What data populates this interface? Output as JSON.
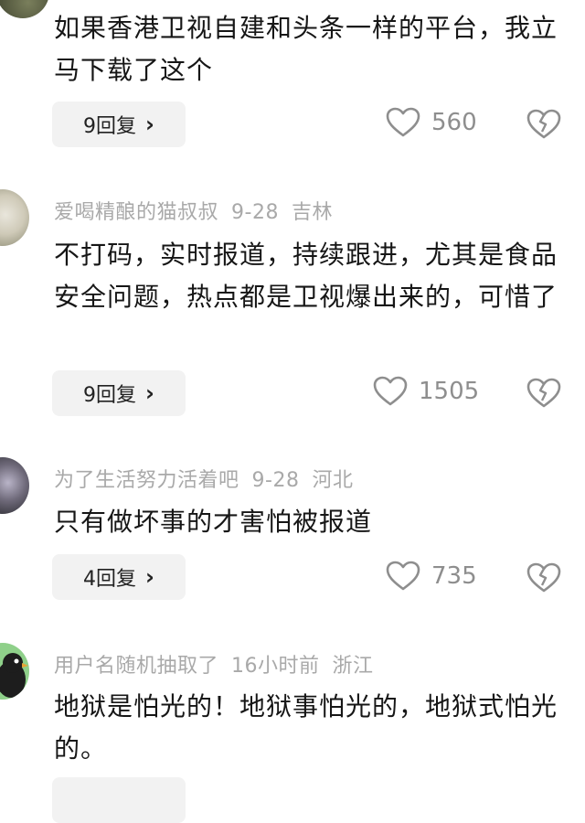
{
  "comments": [
    {
      "content": "如果香港卫视自建和头条一样的平台，我立马下载了这个",
      "replies_label": "9回复",
      "likes": "560"
    },
    {
      "username": "爱喝精酿的猫叔叔",
      "date": "9-28",
      "location": "吉林",
      "content": "不打码，实时报道，持续跟进，尤其是食品安全问题，热点都是卫视爆出来的，可惜了",
      "replies_label": "9回复",
      "likes": "1505"
    },
    {
      "username": "为了生活努力活着吧",
      "date": "9-28",
      "location": "河北",
      "content": "只有做坏事的才害怕被报道",
      "replies_label": "4回复",
      "likes": "735"
    },
    {
      "username": "用户名随机抽取了",
      "date": "16小时前",
      "location": "浙江",
      "content": "地狱是怕光的！地狱事怕光的，地狱式怕光的。"
    }
  ],
  "icons": {
    "like": "heart-outline-icon",
    "dislike": "broken-heart-icon",
    "chevron": "chevron-right-icon"
  },
  "colors": {
    "meta_text": "#a9a9a9",
    "button_bg": "#f2f2f2",
    "icon": "#8e8e8e"
  }
}
